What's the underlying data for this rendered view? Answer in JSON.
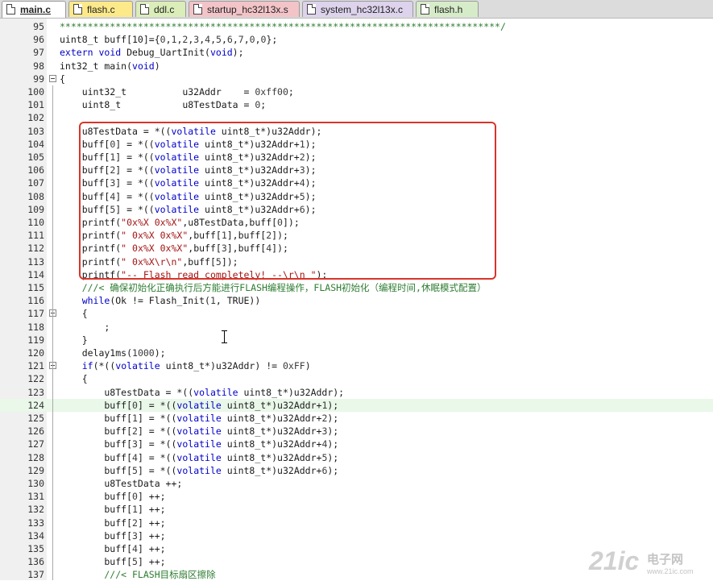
{
  "tabs": [
    {
      "label": "main.c",
      "color": "#ffffff",
      "active": true
    },
    {
      "label": "flash.c",
      "color": "#fbe98a",
      "active": false
    },
    {
      "label": "ddl.c",
      "color": "#dbedb8",
      "active": false
    },
    {
      "label": "startup_hc32l13x.s",
      "color": "#f2c4c8",
      "active": false
    },
    {
      "label": "system_hc32l13x.c",
      "color": "#ddd3ec",
      "active": false
    },
    {
      "label": "flash.h",
      "color": "#d6ecc9",
      "active": false
    }
  ],
  "editor": {
    "current_line": 124,
    "lines": [
      {
        "n": 95,
        "tokens": [
          {
            "t": "*******************************************************************************/",
            "c": "cm"
          }
        ]
      },
      {
        "n": 96,
        "tokens": [
          {
            "t": "uint8_t buff[10]={"
          },
          {
            "t": "0",
            "c": "num"
          },
          {
            "t": ","
          },
          {
            "t": "1",
            "c": "num"
          },
          {
            "t": ","
          },
          {
            "t": "2",
            "c": "num"
          },
          {
            "t": ","
          },
          {
            "t": "3",
            "c": "num"
          },
          {
            "t": ","
          },
          {
            "t": "4",
            "c": "num"
          },
          {
            "t": ","
          },
          {
            "t": "5",
            "c": "num"
          },
          {
            "t": ","
          },
          {
            "t": "6",
            "c": "num"
          },
          {
            "t": ","
          },
          {
            "t": "7",
            "c": "num"
          },
          {
            "t": ","
          },
          {
            "t": "0",
            "c": "num"
          },
          {
            "t": ","
          },
          {
            "t": "0",
            "c": "num"
          },
          {
            "t": "};"
          }
        ]
      },
      {
        "n": 97,
        "tokens": [
          {
            "t": "extern",
            "c": "kw"
          },
          {
            "t": " "
          },
          {
            "t": "void",
            "c": "kw"
          },
          {
            "t": " Debug_UartInit("
          },
          {
            "t": "void",
            "c": "kw"
          },
          {
            "t": ");"
          }
        ]
      },
      {
        "n": 98,
        "tokens": [
          {
            "t": "int32_t main("
          },
          {
            "t": "void",
            "c": "kw"
          },
          {
            "t": ")"
          }
        ]
      },
      {
        "n": 99,
        "tokens": [
          {
            "t": "{"
          }
        ]
      },
      {
        "n": 100,
        "tokens": [
          {
            "t": "    uint32_t          u32Addr    = "
          },
          {
            "t": "0xff00",
            "c": "num"
          },
          {
            "t": ";"
          }
        ]
      },
      {
        "n": 101,
        "tokens": [
          {
            "t": "    uint8_t           u8TestData = "
          },
          {
            "t": "0",
            "c": "num"
          },
          {
            "t": ";"
          }
        ]
      },
      {
        "n": 102,
        "tokens": [
          {
            "t": ""
          }
        ]
      },
      {
        "n": 103,
        "tokens": [
          {
            "t": "    u8TestData = *(("
          },
          {
            "t": "volatile",
            "c": "kw"
          },
          {
            "t": " uint8_t*)u32Addr);"
          }
        ]
      },
      {
        "n": 104,
        "tokens": [
          {
            "t": "    buff["
          },
          {
            "t": "0",
            "c": "num"
          },
          {
            "t": "] = *(("
          },
          {
            "t": "volatile",
            "c": "kw"
          },
          {
            "t": " uint8_t*)u32Addr+"
          },
          {
            "t": "1",
            "c": "num"
          },
          {
            "t": ");"
          }
        ]
      },
      {
        "n": 105,
        "tokens": [
          {
            "t": "    buff["
          },
          {
            "t": "1",
            "c": "num"
          },
          {
            "t": "] = *(("
          },
          {
            "t": "volatile",
            "c": "kw"
          },
          {
            "t": " uint8_t*)u32Addr+"
          },
          {
            "t": "2",
            "c": "num"
          },
          {
            "t": ");"
          }
        ]
      },
      {
        "n": 106,
        "tokens": [
          {
            "t": "    buff["
          },
          {
            "t": "2",
            "c": "num"
          },
          {
            "t": "] = *(("
          },
          {
            "t": "volatile",
            "c": "kw"
          },
          {
            "t": " uint8_t*)u32Addr+"
          },
          {
            "t": "3",
            "c": "num"
          },
          {
            "t": ");"
          }
        ]
      },
      {
        "n": 107,
        "tokens": [
          {
            "t": "    buff["
          },
          {
            "t": "3",
            "c": "num"
          },
          {
            "t": "] = *(("
          },
          {
            "t": "volatile",
            "c": "kw"
          },
          {
            "t": " uint8_t*)u32Addr+"
          },
          {
            "t": "4",
            "c": "num"
          },
          {
            "t": ");"
          }
        ]
      },
      {
        "n": 108,
        "tokens": [
          {
            "t": "    buff["
          },
          {
            "t": "4",
            "c": "num"
          },
          {
            "t": "] = *(("
          },
          {
            "t": "volatile",
            "c": "kw"
          },
          {
            "t": " uint8_t*)u32Addr+"
          },
          {
            "t": "5",
            "c": "num"
          },
          {
            "t": ");"
          }
        ]
      },
      {
        "n": 109,
        "tokens": [
          {
            "t": "    buff["
          },
          {
            "t": "5",
            "c": "num"
          },
          {
            "t": "] = *(("
          },
          {
            "t": "volatile",
            "c": "kw"
          },
          {
            "t": " uint8_t*)u32Addr+"
          },
          {
            "t": "6",
            "c": "num"
          },
          {
            "t": ");"
          }
        ]
      },
      {
        "n": 110,
        "tokens": [
          {
            "t": "    printf("
          },
          {
            "t": "\"0x%X 0x%X\"",
            "c": "str"
          },
          {
            "t": ",u8TestData,buff["
          },
          {
            "t": "0",
            "c": "num"
          },
          {
            "t": "]);"
          }
        ]
      },
      {
        "n": 111,
        "tokens": [
          {
            "t": "    printf("
          },
          {
            "t": "\" 0x%X 0x%X\"",
            "c": "str"
          },
          {
            "t": ",buff["
          },
          {
            "t": "1",
            "c": "num"
          },
          {
            "t": "],buff["
          },
          {
            "t": "2",
            "c": "num"
          },
          {
            "t": "]);"
          }
        ]
      },
      {
        "n": 112,
        "tokens": [
          {
            "t": "    printf("
          },
          {
            "t": "\" 0x%X 0x%X\"",
            "c": "str"
          },
          {
            "t": ",buff["
          },
          {
            "t": "3",
            "c": "num"
          },
          {
            "t": "],buff["
          },
          {
            "t": "4",
            "c": "num"
          },
          {
            "t": "]);"
          }
        ]
      },
      {
        "n": 113,
        "tokens": [
          {
            "t": "    printf("
          },
          {
            "t": "\" 0x%X\\r\\n\"",
            "c": "str"
          },
          {
            "t": ",buff["
          },
          {
            "t": "5",
            "c": "num"
          },
          {
            "t": "]);"
          }
        ]
      },
      {
        "n": 114,
        "tokens": [
          {
            "t": "    printf("
          },
          {
            "t": "\"-- Flash read completely! --\\r\\n \"",
            "c": "str"
          },
          {
            "t": ");"
          }
        ]
      },
      {
        "n": 115,
        "tokens": [
          {
            "t": "    ///< 确保初始化正确执行后方能进行FLASH编程操作，FLASH初始化（编程时间,休眠模式配置）",
            "c": "cm"
          }
        ]
      },
      {
        "n": 116,
        "tokens": [
          {
            "t": "    "
          },
          {
            "t": "while",
            "c": "kw"
          },
          {
            "t": "(Ok != Flash_Init("
          },
          {
            "t": "1",
            "c": "num"
          },
          {
            "t": ", TRUE))"
          }
        ]
      },
      {
        "n": 117,
        "tokens": [
          {
            "t": "    {"
          }
        ]
      },
      {
        "n": 118,
        "tokens": [
          {
            "t": "        ;"
          }
        ]
      },
      {
        "n": 119,
        "tokens": [
          {
            "t": "    }"
          }
        ]
      },
      {
        "n": 120,
        "tokens": [
          {
            "t": "    delay1ms("
          },
          {
            "t": "1000",
            "c": "num"
          },
          {
            "t": ");"
          }
        ]
      },
      {
        "n": 121,
        "tokens": [
          {
            "t": "    "
          },
          {
            "t": "if",
            "c": "kw"
          },
          {
            "t": "(*(("
          },
          {
            "t": "volatile",
            "c": "kw"
          },
          {
            "t": " uint8_t*)u32Addr) != "
          },
          {
            "t": "0xFF",
            "c": "num"
          },
          {
            "t": ")"
          }
        ]
      },
      {
        "n": 122,
        "tokens": [
          {
            "t": "    {"
          }
        ]
      },
      {
        "n": 123,
        "tokens": [
          {
            "t": "        u8TestData = *(("
          },
          {
            "t": "volatile",
            "c": "kw"
          },
          {
            "t": " uint8_t*)u32Addr);"
          }
        ]
      },
      {
        "n": 124,
        "tokens": [
          {
            "t": "        buff["
          },
          {
            "t": "0",
            "c": "num"
          },
          {
            "t": "] = *(("
          },
          {
            "t": "volatile",
            "c": "kw"
          },
          {
            "t": " uint8_t*)u32Addr+"
          },
          {
            "t": "1",
            "c": "num"
          },
          {
            "t": ");"
          }
        ]
      },
      {
        "n": 125,
        "tokens": [
          {
            "t": "        buff["
          },
          {
            "t": "1",
            "c": "num"
          },
          {
            "t": "] = *(("
          },
          {
            "t": "volatile",
            "c": "kw"
          },
          {
            "t": " uint8_t*)u32Addr+"
          },
          {
            "t": "2",
            "c": "num"
          },
          {
            "t": ");"
          }
        ]
      },
      {
        "n": 126,
        "tokens": [
          {
            "t": "        buff["
          },
          {
            "t": "2",
            "c": "num"
          },
          {
            "t": "] = *(("
          },
          {
            "t": "volatile",
            "c": "kw"
          },
          {
            "t": " uint8_t*)u32Addr+"
          },
          {
            "t": "3",
            "c": "num"
          },
          {
            "t": ");"
          }
        ]
      },
      {
        "n": 127,
        "tokens": [
          {
            "t": "        buff["
          },
          {
            "t": "3",
            "c": "num"
          },
          {
            "t": "] = *(("
          },
          {
            "t": "volatile",
            "c": "kw"
          },
          {
            "t": " uint8_t*)u32Addr+"
          },
          {
            "t": "4",
            "c": "num"
          },
          {
            "t": ");"
          }
        ]
      },
      {
        "n": 128,
        "tokens": [
          {
            "t": "        buff["
          },
          {
            "t": "4",
            "c": "num"
          },
          {
            "t": "] = *(("
          },
          {
            "t": "volatile",
            "c": "kw"
          },
          {
            "t": " uint8_t*)u32Addr+"
          },
          {
            "t": "5",
            "c": "num"
          },
          {
            "t": ");"
          }
        ]
      },
      {
        "n": 129,
        "tokens": [
          {
            "t": "        buff["
          },
          {
            "t": "5",
            "c": "num"
          },
          {
            "t": "] = *(("
          },
          {
            "t": "volatile",
            "c": "kw"
          },
          {
            "t": " uint8_t*)u32Addr+"
          },
          {
            "t": "6",
            "c": "num"
          },
          {
            "t": ");"
          }
        ]
      },
      {
        "n": 130,
        "tokens": [
          {
            "t": "        u8TestData ++;"
          }
        ]
      },
      {
        "n": 131,
        "tokens": [
          {
            "t": "        buff["
          },
          {
            "t": "0",
            "c": "num"
          },
          {
            "t": "] ++;"
          }
        ]
      },
      {
        "n": 132,
        "tokens": [
          {
            "t": "        buff["
          },
          {
            "t": "1",
            "c": "num"
          },
          {
            "t": "] ++;"
          }
        ]
      },
      {
        "n": 133,
        "tokens": [
          {
            "t": "        buff["
          },
          {
            "t": "2",
            "c": "num"
          },
          {
            "t": "] ++;"
          }
        ]
      },
      {
        "n": 134,
        "tokens": [
          {
            "t": "        buff["
          },
          {
            "t": "3",
            "c": "num"
          },
          {
            "t": "] ++;"
          }
        ]
      },
      {
        "n": 135,
        "tokens": [
          {
            "t": "        buff["
          },
          {
            "t": "4",
            "c": "num"
          },
          {
            "t": "] ++;"
          }
        ]
      },
      {
        "n": 136,
        "tokens": [
          {
            "t": "        buff["
          },
          {
            "t": "5",
            "c": "num"
          },
          {
            "t": "] ++;"
          }
        ]
      },
      {
        "n": 137,
        "tokens": [
          {
            "t": "        ///< FLASH目标扇区擦除",
            "c": "cm"
          }
        ]
      }
    ]
  },
  "watermark": {
    "brand": "21ic",
    "chinese": "电子网",
    "url": "www.21ic.com"
  }
}
